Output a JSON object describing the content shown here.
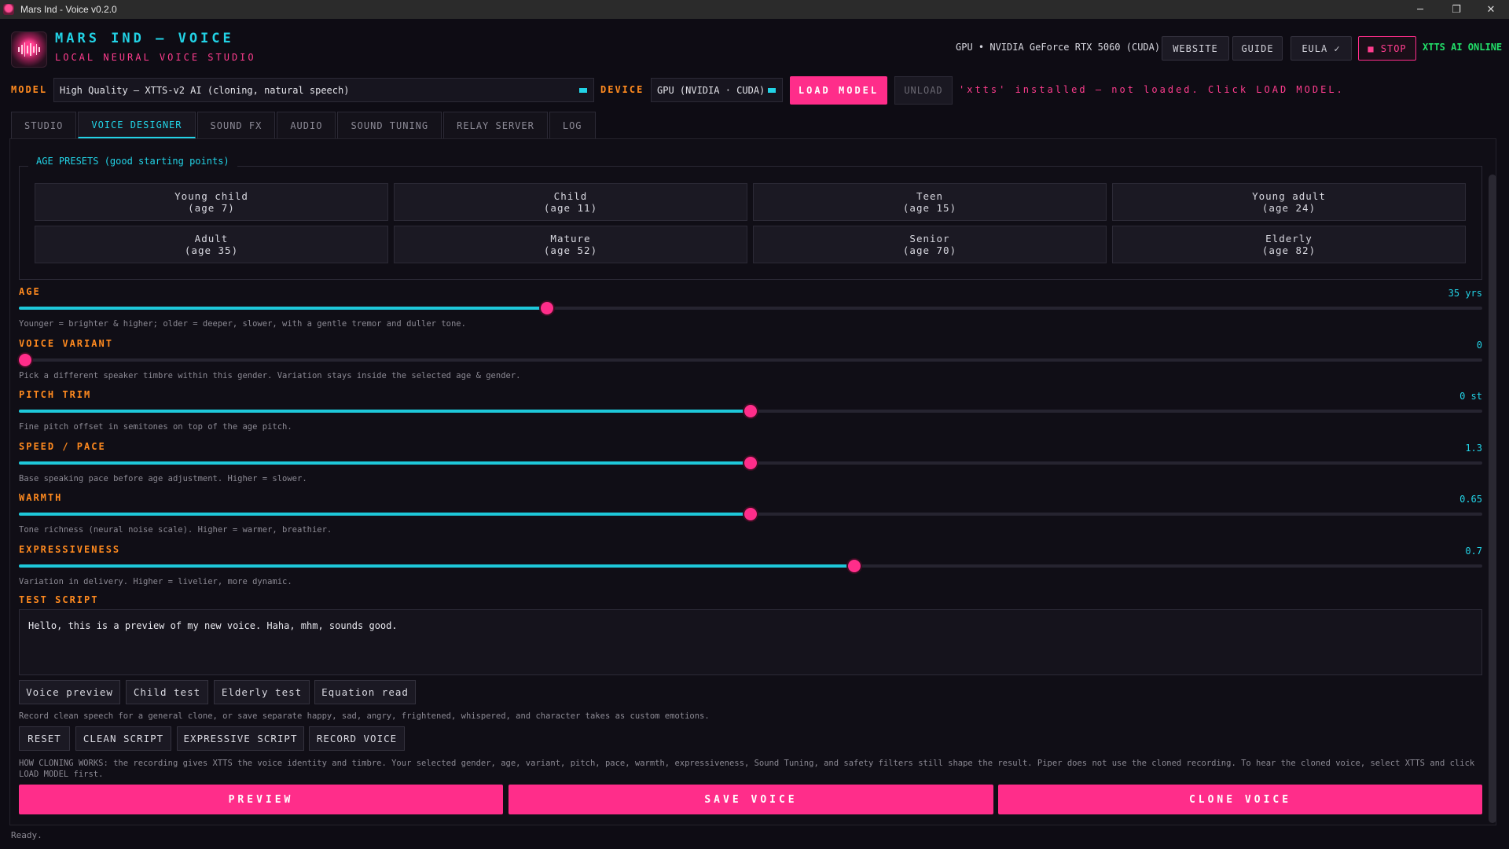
{
  "window": {
    "title": "Mars Ind - Voice v0.2.0",
    "minimize_glyph": "─",
    "restore_glyph": "❐",
    "close_glyph": "✕"
  },
  "header": {
    "brand": "MARS IND — VOICE",
    "tagline": "LOCAL NEURAL VOICE STUDIO",
    "gpu_info": "GPU • NVIDIA GeForce RTX 5060 (CUDA)",
    "website_label": "WEBSITE",
    "guide_label": "GUIDE",
    "eula_label": "EULA ✓",
    "stop_label": "■ STOP",
    "online_status": "XTTS AI ONLINE"
  },
  "model_row": {
    "model_label": "MODEL",
    "model_value": "High Quality — XTTS-v2 AI  (cloning, natural speech)",
    "device_label": "DEVICE",
    "device_value": "GPU (NVIDIA · CUDA)",
    "load_label": "LOAD MODEL",
    "unload_label": "UNLOAD",
    "status": "'xtts' installed — not loaded. Click LOAD MODEL."
  },
  "tabs": [
    "STUDIO",
    "VOICE DESIGNER",
    "SOUND FX",
    "AUDIO",
    "SOUND TUNING",
    "RELAY SERVER",
    "LOG"
  ],
  "active_tab": "VOICE DESIGNER",
  "presets": {
    "legend": "AGE PRESETS  (good starting points)",
    "items": [
      {
        "name": "Young child",
        "age": "(age 7)"
      },
      {
        "name": "Child",
        "age": "(age 11)"
      },
      {
        "name": "Teen",
        "age": "(age 15)"
      },
      {
        "name": "Young adult",
        "age": "(age 24)"
      },
      {
        "name": "Adult",
        "age": "(age 35)"
      },
      {
        "name": "Mature",
        "age": "(age 52)"
      },
      {
        "name": "Senior",
        "age": "(age 70)"
      },
      {
        "name": "Elderly",
        "age": "(age 82)"
      }
    ]
  },
  "sliders": [
    {
      "label": "AGE",
      "value": "35 yrs",
      "fraction": 0.361,
      "help": "Younger = brighter & higher; older = deeper, slower, with a gentle tremor and duller tone."
    },
    {
      "label": "VOICE VARIANT",
      "value": "0",
      "fraction": 0.0,
      "help": "Pick a different speaker timbre within this gender. Variation stays inside the selected age & gender."
    },
    {
      "label": "PITCH TRIM",
      "value": "0 st",
      "fraction": 0.5,
      "help": "Fine pitch offset in semitones on top of the age pitch."
    },
    {
      "label": "SPEED / PACE",
      "value": "1.3",
      "fraction": 0.5,
      "help": "Base speaking pace before age adjustment. Higher = slower."
    },
    {
      "label": "WARMTH",
      "value": "0.65",
      "fraction": 0.5,
      "help": "Tone richness (neural noise scale). Higher = warmer, breathier."
    },
    {
      "label": "EXPRESSIVENESS",
      "value": "0.7",
      "fraction": 0.571,
      "help": "Variation in delivery. Higher = livelier, more dynamic."
    }
  ],
  "test_script": {
    "label": "TEST SCRIPT",
    "text": "Hello, this is a preview of my new voice. Haha, mhm, sounds good.",
    "buttons": [
      "Voice preview",
      "Child test",
      "Elderly test",
      "Equation read"
    ],
    "record_help": "Record clean speech for a general clone, or save separate happy, sad, angry, frightened, whispered, and character takes as custom emotions.",
    "record_buttons": [
      "RESET",
      "CLEAN SCRIPT",
      "EXPRESSIVE SCRIPT",
      "RECORD VOICE"
    ],
    "cloning_help": "HOW CLONING WORKS: the recording gives XTTS the voice identity and timbre. Your selected gender, age, variant, pitch, pace, warmth, expressiveness, Sound Tuning, and safety filters still shape the result. Piper does not use the cloned recording. To hear the cloned voice, select XTTS and click LOAD MODEL first."
  },
  "actions": {
    "preview": "PREVIEW",
    "save": "SAVE VOICE",
    "clone": "CLONE VOICE"
  },
  "status_bar": "Ready.",
  "colors": {
    "accent_pink": "#ff2d8a",
    "accent_cyan": "#22d3e6",
    "label_orange": "#ff8a1f",
    "online_green": "#22e06a",
    "background": "#0e0c14"
  }
}
